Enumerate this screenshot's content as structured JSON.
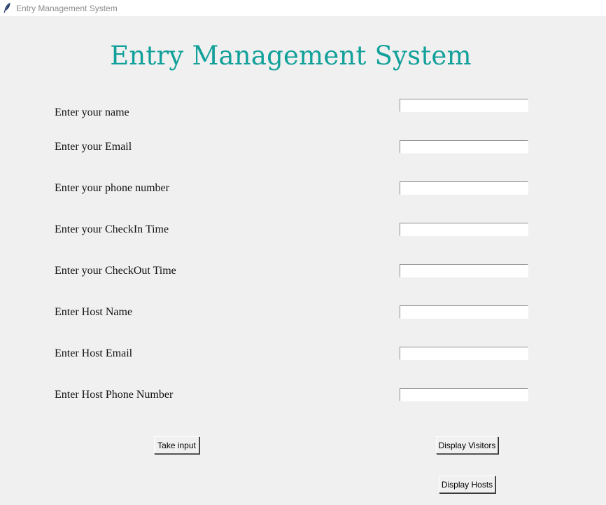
{
  "window": {
    "title": "Entry Management System",
    "icon": "feather-icon"
  },
  "heading": "Entry Management System",
  "heading_color": "#12a09a",
  "form": {
    "fields": [
      {
        "label": "Enter your name",
        "value": ""
      },
      {
        "label": "Enter your Email",
        "value": ""
      },
      {
        "label": "Enter your phone number",
        "value": ""
      },
      {
        "label": "Enter your CheckIn Time",
        "value": ""
      },
      {
        "label": "Enter your CheckOut Time",
        "value": ""
      },
      {
        "label": "Enter Host Name",
        "value": ""
      },
      {
        "label": "Enter Host Email",
        "value": ""
      },
      {
        "label": "Enter Host Phone Number",
        "value": ""
      }
    ]
  },
  "buttons": {
    "take_input": "Take input",
    "display_visitors": "Display Visitors",
    "display_hosts": "Display Hosts"
  }
}
